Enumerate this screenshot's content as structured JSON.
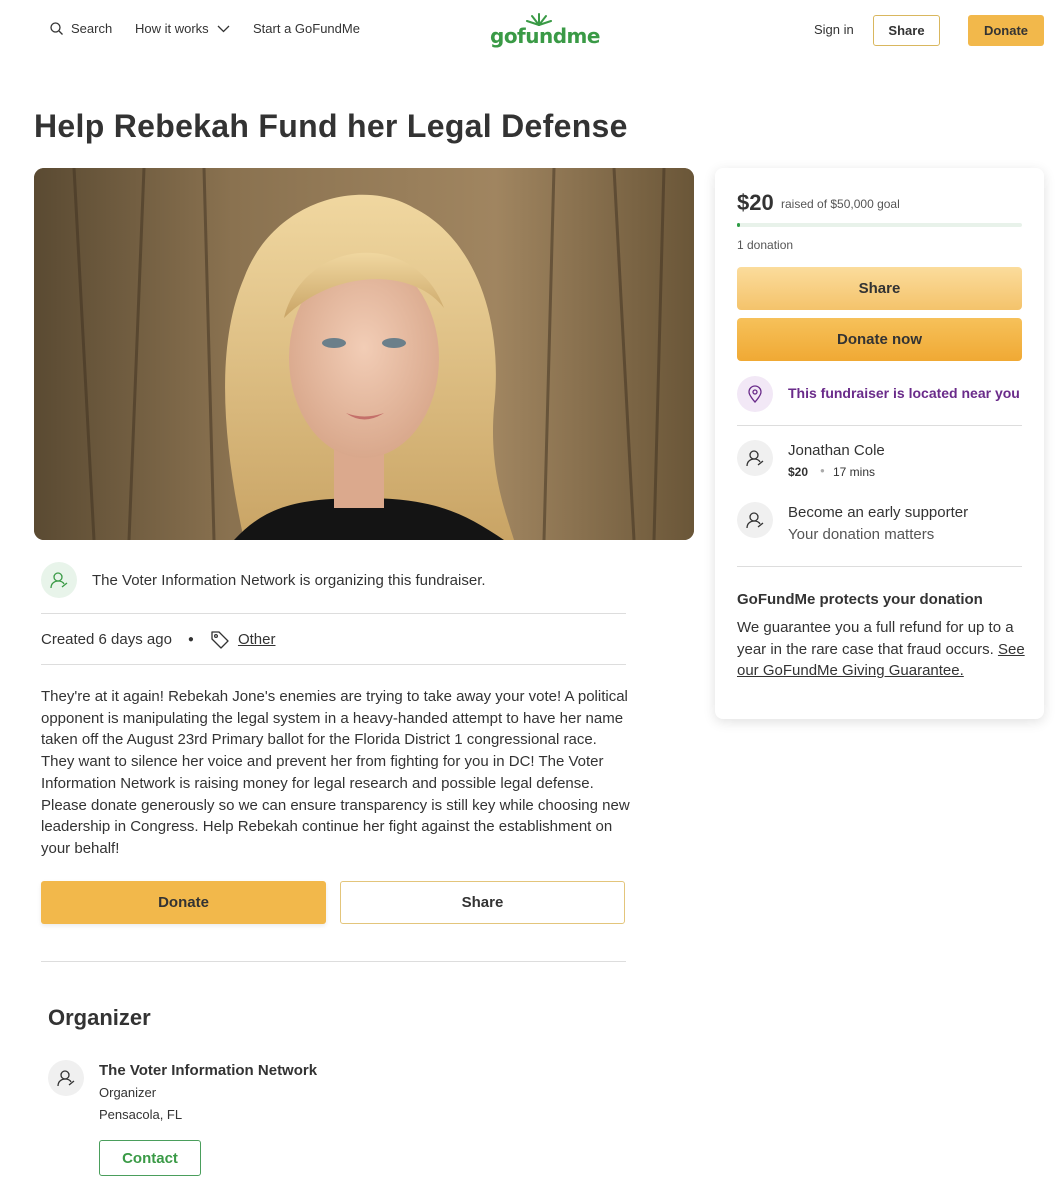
{
  "nav": {
    "search_label": "Search",
    "how_it_works_label": "How it works",
    "start_label": "Start a GoFundMe",
    "logo_text": "gofundme",
    "sign_in_label": "Sign in",
    "share_label": "Share",
    "donate_label": "Donate"
  },
  "campaign": {
    "title": "Help Rebekah Fund her Legal Defense",
    "organizer_line": "The Voter Information Network is organizing this fundraiser.",
    "created": "Created 6 days ago",
    "category": "Other",
    "story": "They're at it again! Rebekah Jone's enemies are trying to take away your vote! A political opponent is manipulating the legal system in a heavy-handed attempt to have her name taken off the August 23rd Primary ballot for the Florida District 1 congressional race. They want to silence her voice and prevent her from fighting for you in DC! The Voter Information Network is raising money for legal research and possible legal defense. Please donate generously so we can ensure transparency is still key while choosing new leadership in Congress. Help Rebekah continue her fight against the establishment on your behalf!",
    "donate_label": "Donate",
    "share_label": "Share"
  },
  "organizer": {
    "heading": "Organizer",
    "name": "The Voter Information Network",
    "role": "Organizer",
    "location": "Pensacola, FL",
    "contact_label": "Contact"
  },
  "sidebar": {
    "raised": "$20",
    "goal_text": "raised of $50,000 goal",
    "progress_fraction": 0.0004,
    "donation_count": "1 donation",
    "share_label": "Share",
    "donate_now_label": "Donate now",
    "location_text": "This fundraiser is located near you",
    "donor": {
      "name": "Jonathan Cole",
      "amount": "$20",
      "time": "17 mins"
    },
    "early_title": "Become an early supporter",
    "early_sub": "Your donation matters",
    "protect_title": "GoFundMe protects your donation",
    "protect_text": "We guarantee you a full refund for up to a year in the rare case that fraud occurs. ",
    "protect_link": "See our GoFundMe Giving Guarantee."
  },
  "colors": {
    "brand_green": "#3a9a46",
    "donate_yellow": "#f2b84b",
    "location_purple": "#6a2b8a"
  }
}
